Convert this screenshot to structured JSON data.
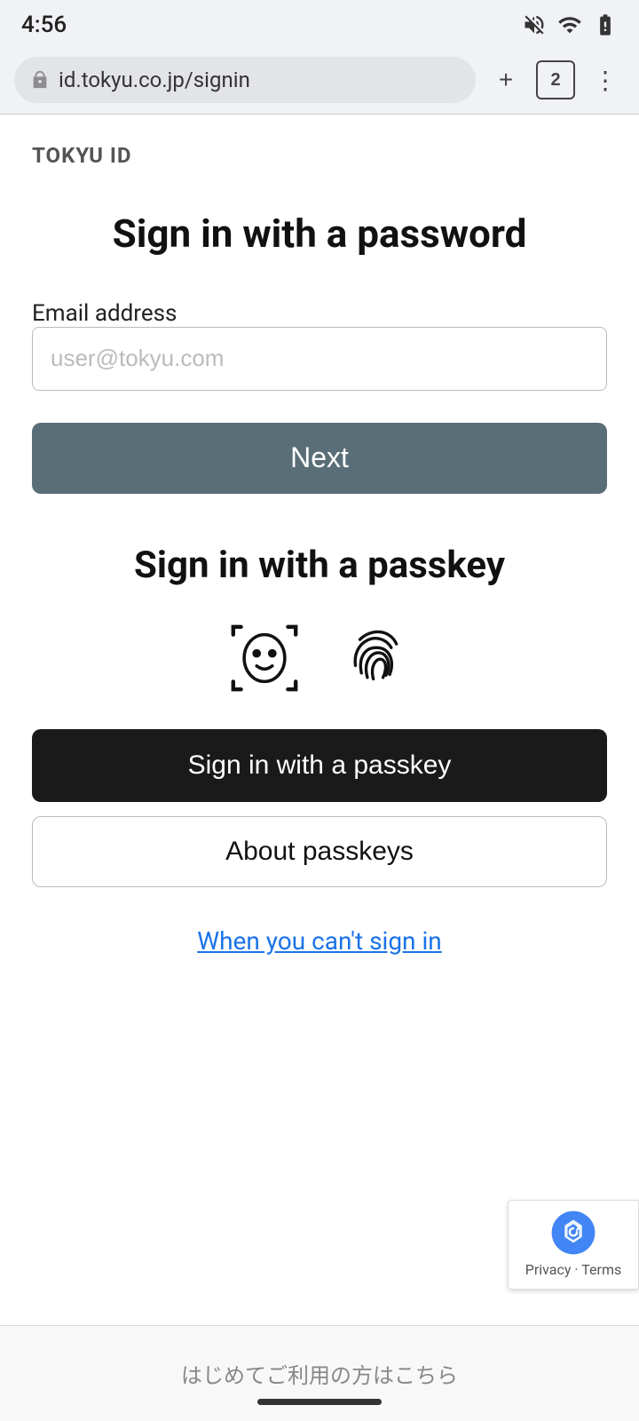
{
  "statusBar": {
    "time": "4:56",
    "icons": [
      "mute",
      "wifi",
      "battery"
    ]
  },
  "browserBar": {
    "url": "id.tokyu.co.jp/signin",
    "tabCount": "2"
  },
  "page": {
    "brandTitle": "TOKYU ID",
    "passwordSection": {
      "heading": "Sign in with a password",
      "emailLabel": "Email address",
      "emailPlaceholder": "user@tokyu.com",
      "nextButton": "Next"
    },
    "passkeySection": {
      "heading": "Sign in with a passkey",
      "passkeyButton": "Sign in with a passkey",
      "aboutButton": "About passkeys"
    },
    "cantSignIn": {
      "linkText": "When you can't sign in"
    },
    "recaptcha": {
      "privacyText": "Privacy",
      "termsText": "Terms"
    },
    "bottomBar": {
      "text": "はじめてご利用の方はこちら"
    }
  }
}
